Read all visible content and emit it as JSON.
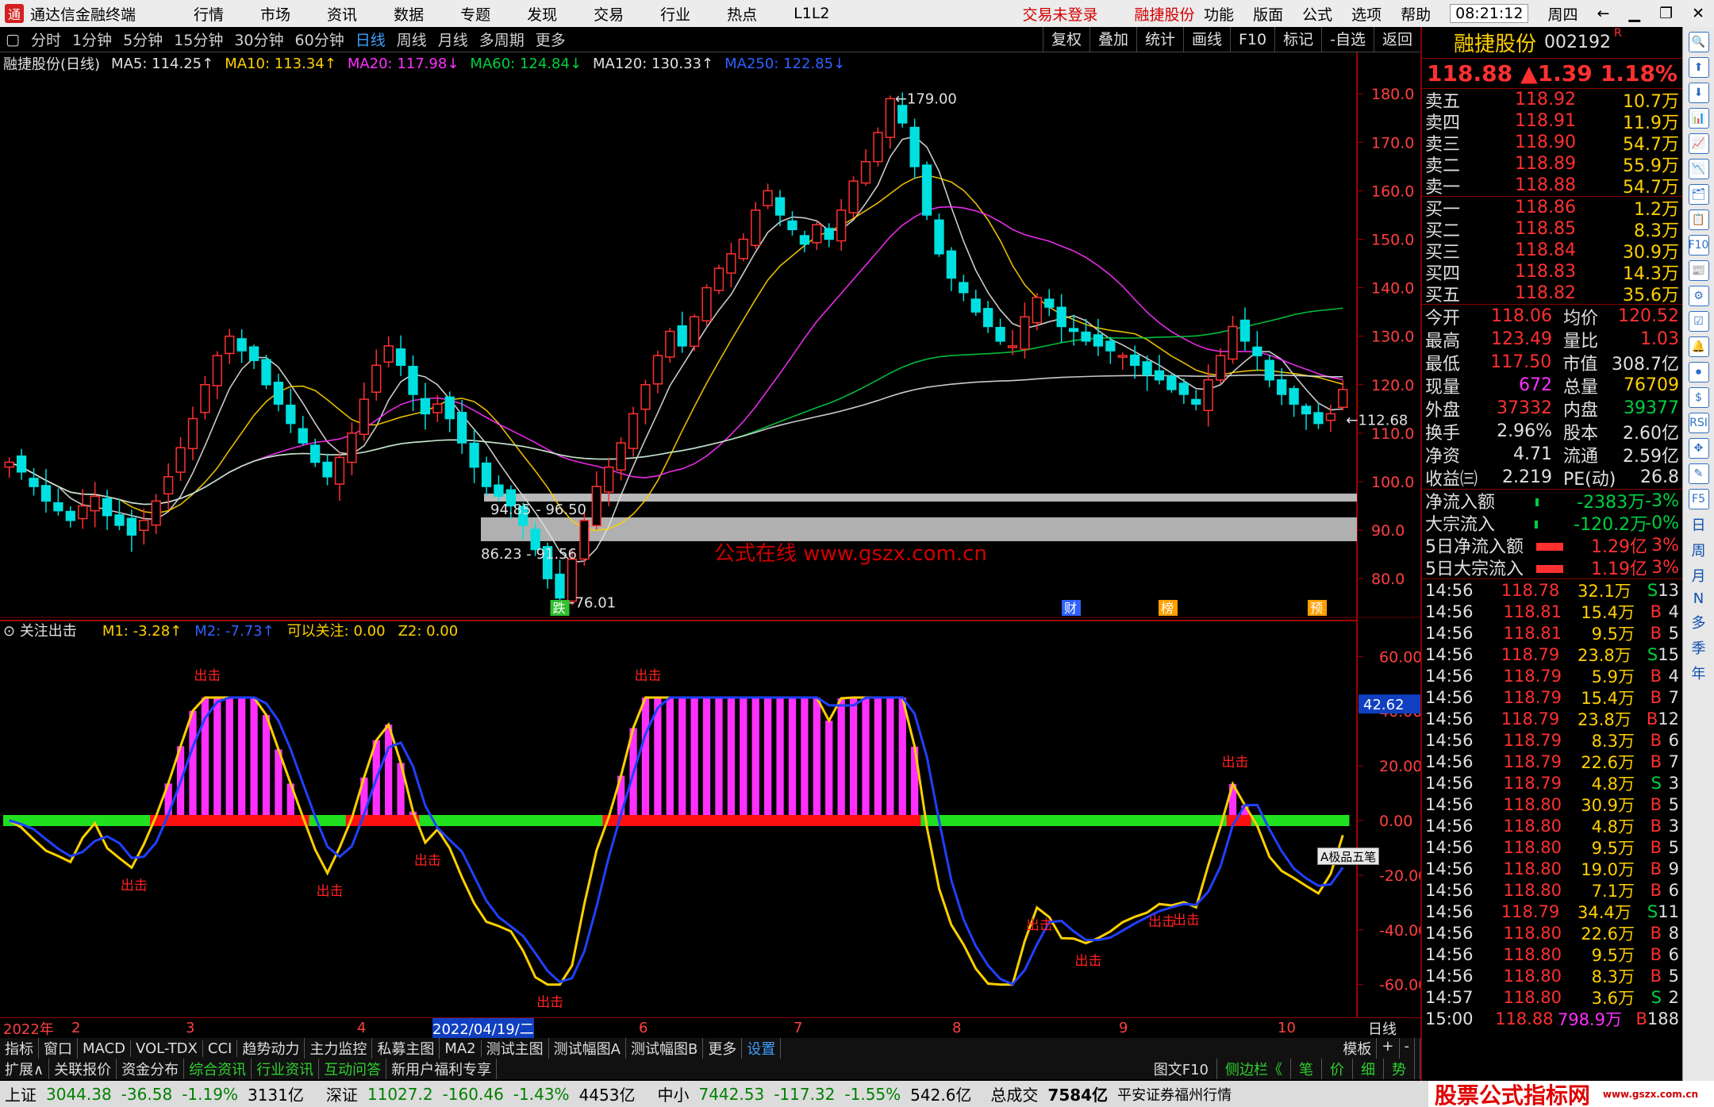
{
  "app": {
    "title": "通达信金融终端",
    "menu": [
      "行情",
      "市场",
      "资讯",
      "数据",
      "专题",
      "发现",
      "交易",
      "行业",
      "热点",
      "L1L2"
    ],
    "trade_status": "交易未登录",
    "stock_link": "融捷股份",
    "right_menu": [
      "功能",
      "版面",
      "公式",
      "选项",
      "帮助"
    ],
    "clock": "08:21:12",
    "weekday": "周四"
  },
  "toolbar": {
    "periods": [
      "分时",
      "1分钟",
      "5分钟",
      "15分钟",
      "30分钟",
      "60分钟",
      "日线",
      "周线",
      "月线",
      "多周期",
      "更多"
    ],
    "active": "日线",
    "right_buttons": [
      "复权",
      "叠加",
      "统计",
      "画线",
      "F10",
      "标记",
      "-自选",
      "返回"
    ]
  },
  "ma_legend": {
    "title": "融捷股份(日线)",
    "items": [
      {
        "text": "MA5: 114.25↑",
        "color": "#e0e0e0"
      },
      {
        "text": "MA10: 113.34↑",
        "color": "#ffd000"
      },
      {
        "text": "MA20: 117.98↓",
        "color": "#ff30ff"
      },
      {
        "text": "MA60: 124.84↓",
        "color": "#00d040"
      },
      {
        "text": "MA120: 130.33↑",
        "color": "#e0e0e0"
      },
      {
        "text": "MA250: 122.85↓",
        "color": "#3060ff"
      }
    ]
  },
  "indicator_legend": {
    "title": "关注出击",
    "items": [
      {
        "text": "M1: -3.28↑",
        "color": "#ffd000"
      },
      {
        "text": "M2: -7.73↑",
        "color": "#3060ff"
      },
      {
        "text": "可以关注: 0.00",
        "color": "#ffd000"
      },
      {
        "text": "Z2: 0.00",
        "color": "#ffd000"
      }
    ]
  },
  "chart_data": {
    "type": "candlestick",
    "title": "融捷股份(日线)",
    "price_axis": {
      "ylim": [
        72,
        182
      ],
      "ticks": [
        180,
        170,
        160,
        150,
        140,
        130,
        120,
        110,
        100,
        90,
        80
      ]
    },
    "indicator_axis": {
      "ylim": [
        -72,
        72
      ],
      "ticks": [
        "60.00",
        "40.00",
        "20.00",
        "0.00",
        "-20.00",
        "-40.00",
        "-60.00"
      ],
      "current": "42.62"
    },
    "annotations": {
      "high": "179.00",
      "low": "76.01",
      "last": "112.68",
      "zone1": "94.85 - 96.50",
      "zone2": "86.23 - 91.56",
      "markers": [
        "跌",
        "财",
        "榜",
        "预"
      ]
    },
    "signal_label": "出击",
    "watermark": "公式在线  www.gszx.com.cn",
    "closes": [
      104,
      102,
      99,
      96,
      94,
      92,
      95,
      97,
      93,
      91,
      89,
      92,
      96,
      101,
      107,
      113,
      120,
      126,
      130,
      127,
      125,
      120,
      116,
      112,
      108,
      104,
      101,
      105,
      110,
      117,
      124,
      128,
      124,
      118,
      114,
      116,
      113,
      108,
      103,
      99,
      97,
      95,
      91,
      86,
      80,
      76,
      84,
      92,
      99,
      103,
      108,
      114,
      120,
      126,
      131,
      128,
      134,
      140,
      144,
      147,
      150,
      156,
      160,
      155,
      152,
      149,
      153,
      150,
      156,
      162,
      166,
      172,
      179,
      174,
      165,
      155,
      147,
      142,
      139,
      135,
      132,
      129,
      128,
      134,
      138,
      136,
      132,
      131,
      129,
      128,
      127,
      126,
      124,
      122,
      121,
      119,
      118,
      116,
      121,
      126,
      132,
      129,
      126,
      121,
      118,
      116,
      114,
      112,
      114,
      119
    ],
    "dates": [
      "2022年",
      "2",
      "3",
      "4",
      "2022/04/19/二",
      "6",
      "7",
      "8",
      "9",
      "10"
    ],
    "axis_label": "日线"
  },
  "order_book": {
    "name": "融捷股份",
    "code": "002192",
    "flag": "R",
    "price": "118.88",
    "change": "▲1.39",
    "pct": "1.18%",
    "asks": [
      {
        "label": "卖五",
        "price": "118.92",
        "vol": "10.7万"
      },
      {
        "label": "卖四",
        "price": "118.91",
        "vol": "11.9万"
      },
      {
        "label": "卖三",
        "price": "118.90",
        "vol": "54.7万"
      },
      {
        "label": "卖二",
        "price": "118.89",
        "vol": "55.9万"
      },
      {
        "label": "卖一",
        "price": "118.88",
        "vol": "54.7万"
      }
    ],
    "bids": [
      {
        "label": "买一",
        "price": "118.86",
        "vol": "1.2万"
      },
      {
        "label": "买二",
        "price": "118.85",
        "vol": "8.3万"
      },
      {
        "label": "买三",
        "price": "118.84",
        "vol": "30.9万"
      },
      {
        "label": "买四",
        "price": "118.83",
        "vol": "14.3万"
      },
      {
        "label": "买五",
        "price": "118.82",
        "vol": "35.6万"
      }
    ]
  },
  "quote_stats": [
    {
      "k1": "今开",
      "v1": "118.06",
      "c1": "#ff3030",
      "k2": "均价",
      "v2": "120.52",
      "c2": "#ff3030"
    },
    {
      "k1": "最高",
      "v1": "123.49",
      "c1": "#ff3030",
      "k2": "量比",
      "v2": "1.03",
      "c2": "#ff3030"
    },
    {
      "k1": "最低",
      "v1": "117.50",
      "c1": "#ff3030",
      "k2": "市值",
      "v2": "308.7亿",
      "c2": "#e0e0e0"
    },
    {
      "k1": "现量",
      "v1": "672",
      "c1": "#ff30ff",
      "k2": "总量",
      "v2": "76709",
      "c2": "#ffd000"
    },
    {
      "k1": "外盘",
      "v1": "37332",
      "c1": "#ff3030",
      "k2": "内盘",
      "v2": "39377",
      "c2": "#00d040"
    },
    {
      "k1": "换手",
      "v1": "2.96%",
      "c1": "#e0e0e0",
      "k2": "股本",
      "v2": "2.60亿",
      "c2": "#e0e0e0"
    },
    {
      "k1": "净资",
      "v1": "4.71",
      "c1": "#e0e0e0",
      "k2": "流通",
      "v2": "2.59亿",
      "c2": "#e0e0e0"
    },
    {
      "k1": "收益㈢",
      "v1": "2.219",
      "c1": "#e0e0e0",
      "k2": "PE(动)",
      "v2": "26.8",
      "c2": "#e0e0e0"
    }
  ],
  "fund_flow": [
    {
      "label": "净流入额",
      "value": "-2383万",
      "pct": "-3%",
      "color": "#00d040",
      "bar": "#00d040"
    },
    {
      "label": "大宗流入",
      "value": "-120.2万",
      "pct": "-0%",
      "color": "#00d040",
      "bar": "#00d040"
    },
    {
      "label": "5日净流入额",
      "value": "1.29亿",
      "pct": "3%",
      "color": "#ff3030",
      "bar": "#ff3030"
    },
    {
      "label": "5日大宗流入",
      "value": "1.19亿",
      "pct": "3%",
      "color": "#ff3030",
      "bar": "#ff3030"
    }
  ],
  "ticks": [
    {
      "t": "14:56",
      "p": "118.78",
      "v": "32.1万",
      "s": "S",
      "n": "13"
    },
    {
      "t": "14:56",
      "p": "118.81",
      "v": "15.4万",
      "s": "B",
      "n": "4"
    },
    {
      "t": "14:56",
      "p": "118.81",
      "v": "9.5万",
      "s": "B",
      "n": "5"
    },
    {
      "t": "14:56",
      "p": "118.79",
      "v": "23.8万",
      "s": "S",
      "n": "15"
    },
    {
      "t": "14:56",
      "p": "118.79",
      "v": "5.9万",
      "s": "B",
      "n": "4"
    },
    {
      "t": "14:56",
      "p": "118.79",
      "v": "15.4万",
      "s": "B",
      "n": "7"
    },
    {
      "t": "14:56",
      "p": "118.79",
      "v": "23.8万",
      "s": "B",
      "n": "12"
    },
    {
      "t": "14:56",
      "p": "118.79",
      "v": "8.3万",
      "s": "B",
      "n": "6"
    },
    {
      "t": "14:56",
      "p": "118.79",
      "v": "22.6万",
      "s": "B",
      "n": "7"
    },
    {
      "t": "14:56",
      "p": "118.79",
      "v": "4.8万",
      "s": "S",
      "n": "3"
    },
    {
      "t": "14:56",
      "p": "118.80",
      "v": "30.9万",
      "s": "B",
      "n": "5"
    },
    {
      "t": "14:56",
      "p": "118.80",
      "v": "4.8万",
      "s": "B",
      "n": "3"
    },
    {
      "t": "14:56",
      "p": "118.80",
      "v": "9.5万",
      "s": "B",
      "n": "5"
    },
    {
      "t": "14:56",
      "p": "118.80",
      "v": "19.0万",
      "s": "B",
      "n": "9"
    },
    {
      "t": "14:56",
      "p": "118.80",
      "v": "7.1万",
      "s": "B",
      "n": "6"
    },
    {
      "t": "14:56",
      "p": "118.79",
      "v": "34.4万",
      "s": "S",
      "n": "11"
    },
    {
      "t": "14:56",
      "p": "118.80",
      "v": "22.6万",
      "s": "B",
      "n": "8"
    },
    {
      "t": "14:56",
      "p": "118.80",
      "v": "9.5万",
      "s": "B",
      "n": "6"
    },
    {
      "t": "14:56",
      "p": "118.80",
      "v": "8.3万",
      "s": "B",
      "n": "5"
    },
    {
      "t": "14:57",
      "p": "118.80",
      "v": "3.6万",
      "s": "S",
      "n": "2"
    },
    {
      "t": "15:00",
      "p": "118.88",
      "v": "798.9万",
      "s": "B",
      "n": "188"
    }
  ],
  "bottom_tabs": [
    "指标",
    "窗口",
    "MACD",
    "VOL-TDX",
    "CCI",
    "趋势动力",
    "主力监控",
    "私募主图",
    "MA2",
    "测试主图",
    "测试幅图A",
    "测试幅图B",
    "更多",
    "设置"
  ],
  "bottom_tabs_right": [
    "模板",
    "+",
    "-"
  ],
  "bottom_tabs2": [
    "扩展∧",
    "关联报价",
    "资金分布",
    "综合资讯",
    "行业资讯",
    "互动问答",
    "新用户福利专享"
  ],
  "bottom_tabs2_right": [
    "图文F10",
    "侧边栏《",
    "笔",
    "价",
    "细",
    "势"
  ],
  "float_btn": "A极品五笔",
  "status": [
    {
      "name": "上证",
      "val": "3044.38",
      "chg": "-36.58",
      "pct": "-1.19%",
      "amt": "3131亿"
    },
    {
      "name": "深证",
      "val": "11027.2",
      "chg": "-160.46",
      "pct": "-1.43%",
      "amt": "4453亿"
    },
    {
      "name": "中小",
      "val": "7442.53",
      "chg": "-117.32",
      "pct": "-1.55%",
      "amt": "542.6亿"
    }
  ],
  "status_total": "总成交",
  "status_total_val": "7584亿",
  "status_source": "平安证券福州行情",
  "status_wm": "股票公式指标网",
  "status_wm_url": "www.gszx.com.cn",
  "side_icons": [
    "🔍",
    "⬆",
    "⬇",
    "📊",
    "📈",
    "📉",
    "🗂",
    "📋",
    "F10",
    "📰",
    "⚙",
    "☑",
    "🔔",
    "⏺",
    "$",
    "RSI",
    "✥",
    "✎",
    "F5"
  ],
  "side_chars": [
    "日",
    "周",
    "月",
    "N",
    "多",
    "季",
    "年"
  ]
}
